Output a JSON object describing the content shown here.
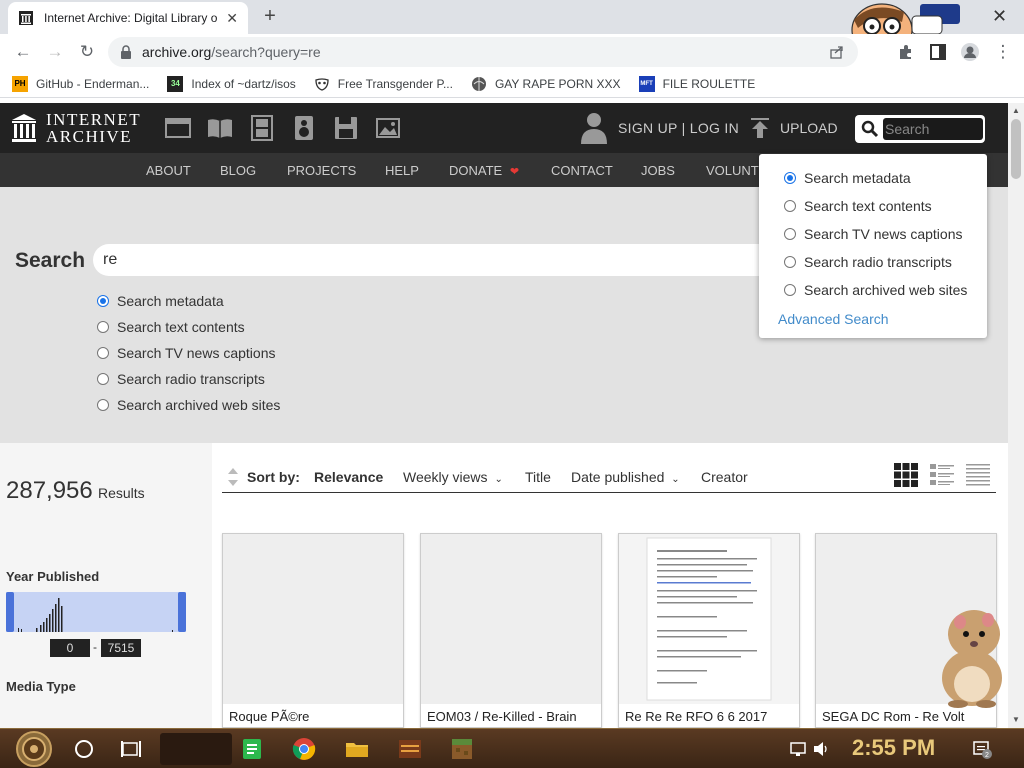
{
  "browser": {
    "tab_title": "Internet Archive: Digital Library o",
    "url_host": "archive.org",
    "url_path": "/search?query=re",
    "bookmarks": [
      {
        "label": "GitHub - Enderman...",
        "icon": "ph-icon"
      },
      {
        "label": "Index of ~dartz/isos",
        "icon": "dir-icon"
      },
      {
        "label": "Free Transgender P...",
        "icon": "mask-icon"
      },
      {
        "label": "GAY RAPE PORN XXX",
        "icon": "globe-icon"
      },
      {
        "label": "FILE ROULETTE",
        "icon": "mft-icon"
      }
    ],
    "bookmark_icon_texts": {
      "ph": "PH",
      "dir": "34",
      "mft": "MFT"
    }
  },
  "ia": {
    "logo_line1": "INTERNET",
    "logo_line2": "ARCHIVE",
    "signup": "SIGN UP | LOG IN",
    "upload": "UPLOAD",
    "search_placeholder": "Search",
    "nav": [
      "ABOUT",
      "BLOG",
      "PROJECTS",
      "HELP",
      "DONATE",
      "CONTACT",
      "JOBS",
      "VOLUNTE"
    ],
    "search_label": "Search",
    "query": "re",
    "options": [
      {
        "label": "Search metadata",
        "checked": true
      },
      {
        "label": "Search text contents",
        "checked": false
      },
      {
        "label": "Search TV news captions",
        "checked": false
      },
      {
        "label": "Search radio transcripts",
        "checked": false
      },
      {
        "label": "Search archived web sites",
        "checked": false
      }
    ],
    "dropdown": {
      "options": [
        {
          "label": "Search metadata",
          "checked": true
        },
        {
          "label": "Search text contents",
          "checked": false
        },
        {
          "label": "Search TV news captions",
          "checked": false
        },
        {
          "label": "Search radio transcripts",
          "checked": false
        },
        {
          "label": "Search archived web sites",
          "checked": false
        }
      ],
      "advanced": "Advanced Search"
    },
    "results": {
      "count": "287,956",
      "label": "Results",
      "year_published": "Year Published",
      "year_min": "0",
      "year_max": "7515",
      "media_type": "Media Type"
    },
    "sort": {
      "label": "Sort by:",
      "options": [
        "Relevance",
        "Weekly views",
        "Title",
        "Date published",
        "Creator"
      ]
    },
    "cards": [
      {
        "title": "Roque PÃ©re"
      },
      {
        "title": "EOM03 / Re-Killed - Brain"
      },
      {
        "title": "Re Re Re RFO 6 6 2017"
      },
      {
        "title": "SEGA DC Rom - Re Volt"
      }
    ],
    "colors": {
      "dark": "#222222",
      "nav": "#333333",
      "link": "#428bca",
      "donate_heart": "#e53935"
    }
  },
  "taskbar": {
    "clock": "2:55 PM",
    "notifications": "2"
  }
}
